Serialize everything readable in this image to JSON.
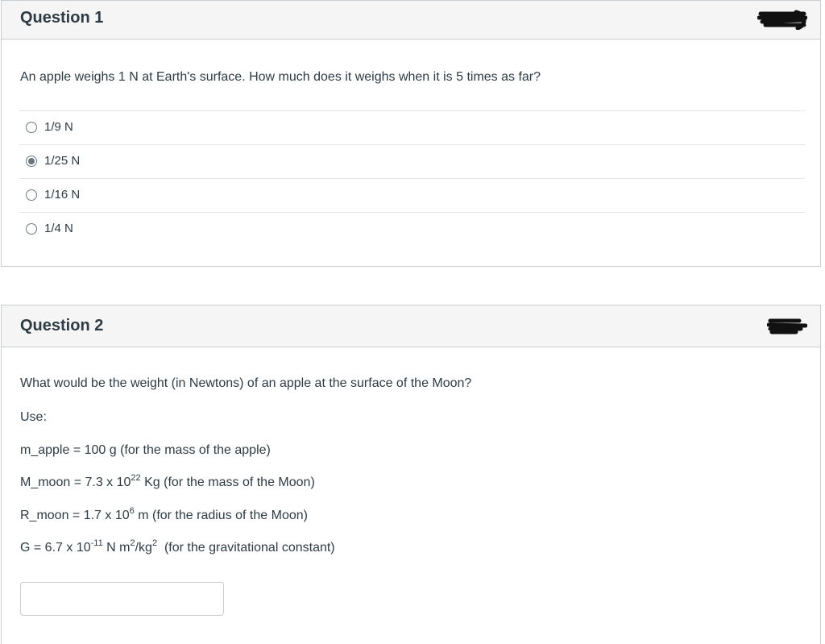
{
  "question1": {
    "title": "Question 1",
    "prompt": "An apple weighs 1 N at Earth's surface. How much does it weighs when it is 5 times as far?",
    "answers": [
      {
        "label": "1/9 N",
        "selected": false
      },
      {
        "label": "1/25 N",
        "selected": true
      },
      {
        "label": "1/16 N",
        "selected": false
      },
      {
        "label": "1/4 N",
        "selected": false
      }
    ]
  },
  "question2": {
    "title": "Question 2",
    "prompt": "What would be the weight (in Newtons) of an apple at the surface of the Moon?",
    "use_label": "Use:",
    "m_apple": "m_apple = 100 g (for the mass of the apple)",
    "M_moon": {
      "pre": "M_moon = 7.3 x 10",
      "exp": "22",
      "post": " Kg (for the mass of the Moon)"
    },
    "R_moon": {
      "pre": "R_moon = 1.7 x 10",
      "exp": "6",
      "post": " m (for the radius of the Moon)"
    },
    "G": {
      "pre": "G = 6.7 x 10",
      "exp": "-11",
      "mid": " N m",
      "exp2": "2",
      "mid2": "/kg",
      "exp3": "2",
      "post": "  (for the gravitational constant)"
    },
    "answer_value": ""
  },
  "colors": {
    "text": "#2d3b45",
    "border": "#c7cdd1",
    "header_bg": "#f5f5f5"
  }
}
